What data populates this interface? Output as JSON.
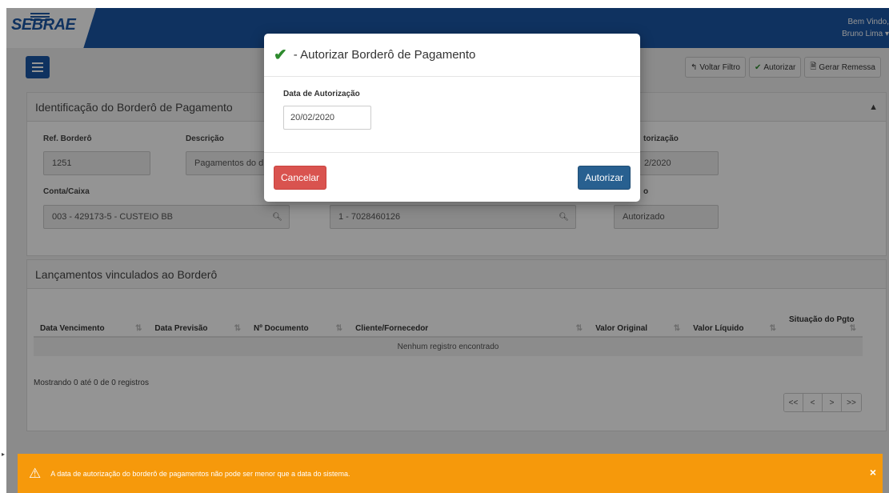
{
  "header": {
    "logo": "SEBRAE",
    "welcome": "Bem Vindo,",
    "user": "Bruno Lima ▾"
  },
  "toolbar": {
    "back_label": "Voltar Filtro",
    "authorize_label": "Autorizar",
    "remessa_label": "Gerar Remessa"
  },
  "panel_id": {
    "title": "Identificação do Borderô de Pagamento",
    "ref_label": "Ref. Borderô",
    "ref_value": "1251",
    "desc_label": "Descrição",
    "desc_value": "Pagamentos do d",
    "auth_date_label": "torização",
    "auth_date_value": "2/2020",
    "account_label": "Conta/Caixa",
    "account_value": "003 - 429173-5 - CUSTEIO BB",
    "second_label": "",
    "second_value": "1 - 7028460126",
    "status_label": "o",
    "status_value": "Autorizado"
  },
  "panel_launch": {
    "title": "Lançamentos vinculados ao Borderô",
    "columns": [
      "Data Vencimento",
      "Data Previsão",
      "Nº Documento",
      "Cliente/Fornecedor",
      "Valor Original",
      "Valor Líquido",
      "Situação do Pgto"
    ],
    "empty": "Nenhum registro encontrado",
    "showing": "Mostrando 0 até 0 de 0 registros",
    "pager": [
      "<<",
      "<",
      ">",
      ">>"
    ]
  },
  "modal": {
    "title": "- Autorizar Borderô de Pagamento",
    "date_label": "Data de Autorização",
    "date_value": "20/02/2020",
    "cancel_label": "Cancelar",
    "confirm_label": "Autorizar"
  },
  "alert": {
    "message": "A data de autorização do borderô de pagamentos não pode ser menor que a data do sistema.",
    "close": "×"
  },
  "colors": {
    "brand": "#1a56a6",
    "danger": "#d9534f",
    "primary": "#286090",
    "warning": "#f6990b",
    "success": "#2e8b2e"
  }
}
